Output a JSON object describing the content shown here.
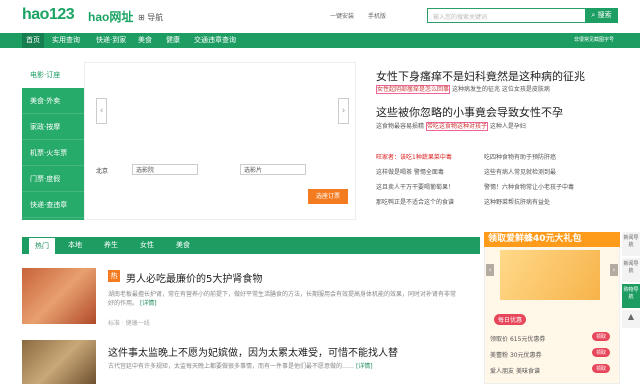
{
  "header": {
    "logo": "hao123",
    "sublogo": "hao网址",
    "nav_label": "⊞ 导航",
    "topbar_links": [
      "一键安装",
      "手机版"
    ],
    "search_placeholder": "输入您的搜索关键词",
    "search_button": "搜索"
  },
  "nav": {
    "items": [
      "首页",
      "实用查询",
      "快递·到家",
      "美食",
      "健康",
      "交通违章查询"
    ],
    "right_text": "非很常见截图字号"
  },
  "left_menu": [
    "电影·订座",
    "美食·外卖",
    "家政·按摩",
    "机票·火车票",
    "门票·度假",
    "快递·查违章"
  ],
  "booking": {
    "city": "北京",
    "cinema_placeholder": "选影院",
    "movie_placeholder": "选影片",
    "submit": "选座订票"
  },
  "news_top": [
    {
      "title": "女性下身瘙痒不是妇科竟然是这种病的征兆",
      "sub": [
        "女性起阴部瘙痒是怎么回事",
        "这种病发生的征兆",
        "这位女孩是皮肤病"
      ]
    },
    {
      "title": "这些被你忽略的小事竟会导致女性不孕",
      "sub": [
        "这食物最容易损精",
        "带吃这食物这种对孩子",
        "这种人是孕妇"
      ]
    }
  ],
  "news_links": [
    [
      "旺家者：该吃1种蔬果菜中毒",
      "吃四种食物有助于预防肝癌"
    ],
    [
      "这样做是喝茶 警惕全面毒",
      "这些有病人常见就检测到最"
    ],
    [
      "这且卖人干万干要喝葡萄果！",
      "警惕！六种食物常让小老孩子中毒"
    ],
    [
      "那吃鸭正是不适合这个的食谱",
      "这种野菜帮抗肝病有益处"
    ]
  ],
  "tabs": [
    "热门",
    "本地",
    "养生",
    "女性",
    "美食"
  ],
  "articles": [
    {
      "badge": "热",
      "title": "男人必吃最廉价的5大护肾食物",
      "desc": "湖南老板最擅长护肾，常在有营养小的前提下，做好平常生活膳食的方法，长期服用会有效提高身体机能的效果，同时对补肾有非常好的作用。",
      "meta": "标准 · 健康一线",
      "more": "[详情]"
    },
    {
      "badge": "",
      "title": "这件事太监晚上不愿为妃嫔做，因为太累太难受，可惜不能找人替",
      "desc": "古代宫廷中有许多规矩，太监每天晚上都要做很多事情，而有一件事是他们最不愿意做的……",
      "meta": "",
      "more": "[详情]"
    }
  ],
  "ad": {
    "top": "领取爱鲜蜂40元大礼包",
    "daily_label": "每日优惠",
    "rows": [
      [
        "领取价",
        "615元优惠券"
      ],
      [
        "美蕾粉",
        "30元优惠券"
      ],
      [
        "爱人朋友",
        "美味食谱"
      ]
    ],
    "action": "领取"
  },
  "side_tabs": [
    "新闻导航",
    "新闻导航",
    "购物导航"
  ]
}
